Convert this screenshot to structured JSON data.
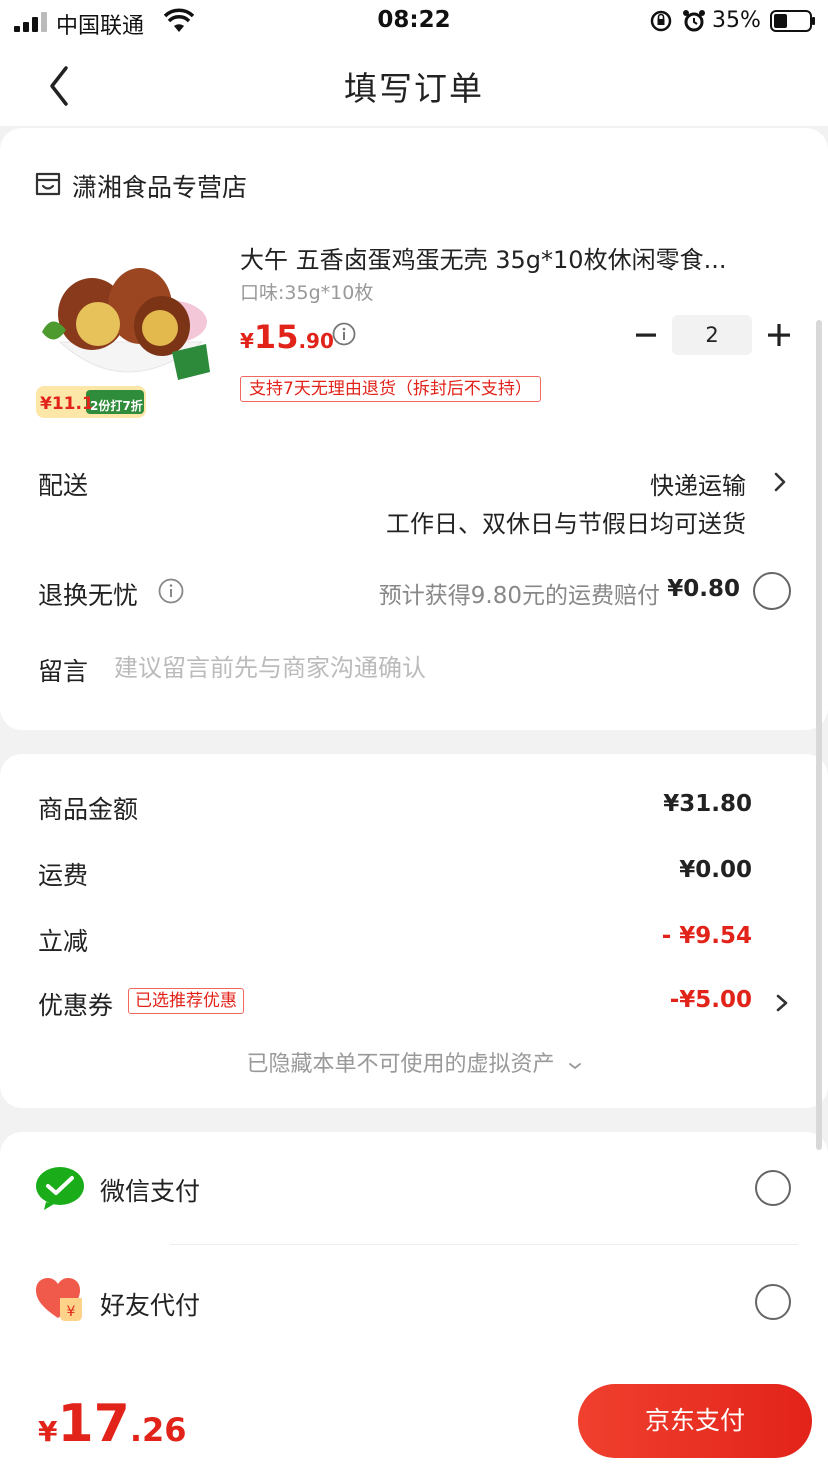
{
  "status_bar": {
    "carrier": "中国联通",
    "time": "08:22",
    "battery": "35%"
  },
  "nav": {
    "title": "填写订单"
  },
  "shop": {
    "name": "潇湘食品专营店"
  },
  "product": {
    "title": "大午 五香卤蛋鸡蛋无壳 35g*10枚休闲零食...",
    "spec": "口味:35g*10枚",
    "price_currency": "¥",
    "price_int": "15",
    "price_dec": ".90",
    "quantity": "2",
    "return_policy": "支持7天无理由退货（拆封后不支持）",
    "image_badge_price": "¥11.1",
    "image_badge_text": "2份打7折"
  },
  "delivery": {
    "label": "配送",
    "method": "快递运输",
    "note": "工作日、双休日与节假日均可送货"
  },
  "return_insurance": {
    "label": "退换无忧",
    "description": "预计获得9.80元的运费赔付",
    "price": "¥0.80"
  },
  "remark": {
    "label": "留言",
    "placeholder": "建议留言前先与商家沟通确认"
  },
  "summary": {
    "goods_label": "商品金额",
    "goods_value": "¥31.80",
    "shipping_label": "运费",
    "shipping_value": "¥0.00",
    "discount_label": "立减",
    "discount_value": "- ¥9.54",
    "coupon_label": "优惠券",
    "coupon_tag": "已选推荐优惠",
    "coupon_value": "-¥5.00",
    "hidden_assets": "已隐藏本单不可使用的虚拟资产"
  },
  "payment_methods": [
    {
      "label": "微信支付",
      "icon": "wechat-pay-icon"
    },
    {
      "label": "好友代付",
      "icon": "friend-pay-icon"
    }
  ],
  "bottom": {
    "total_currency": "¥",
    "total_int": "17",
    "total_dec": ".26",
    "pay_button": "京东支付"
  },
  "colors": {
    "accent_red": "#e2231a",
    "wechat_green": "#1aad19"
  }
}
